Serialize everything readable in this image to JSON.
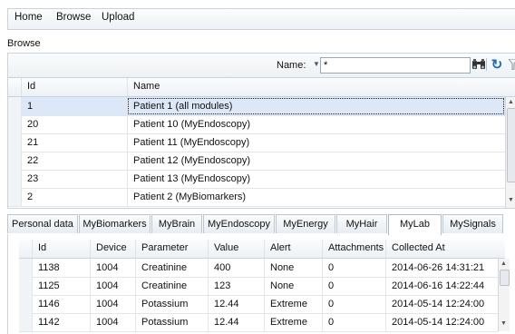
{
  "menu": {
    "items": [
      "Home",
      "Browse",
      "Upload"
    ]
  },
  "breadcrumb": "Browse",
  "filter": {
    "label": "Name:",
    "value": "*"
  },
  "patients": {
    "columns": [
      "Id",
      "Name"
    ],
    "rows": [
      [
        "1",
        "Patient 1 (all modules)"
      ],
      [
        "20",
        "Patient 10 (MyEndoscopy)"
      ],
      [
        "21",
        "Patient 11 (MyEndoscopy)"
      ],
      [
        "22",
        "Patient 12 (MyEndoscopy)"
      ],
      [
        "23",
        "Patient 13 (MyEndoscopy)"
      ],
      [
        "2",
        "Patient 2 (MyBiomarkers)"
      ]
    ],
    "selected_index": 0
  },
  "tabs": {
    "items": [
      "Personal data",
      "MyBiomarkers",
      "MyBrain",
      "MyEndoscopy",
      "MyEnergy",
      "MyHair",
      "MyLab",
      "MySignals"
    ],
    "active": "MyLab"
  },
  "lab": {
    "columns": [
      "Id",
      "Device",
      "Parameter",
      "Value",
      "Alert",
      "Attachments",
      "Collected At"
    ],
    "rows": [
      [
        "1138",
        "1004",
        "Creatinine",
        "400",
        "None",
        "0",
        "2014-06-26 14:31:21"
      ],
      [
        "1125",
        "1004",
        "Creatinine",
        "123",
        "None",
        "0",
        "2014-06-16 14:22:44"
      ],
      [
        "1146",
        "1004",
        "Potassium",
        "12.44",
        "Extreme",
        "0",
        "2014-05-14 12:24:00"
      ],
      [
        "1142",
        "1004",
        "Potassium",
        "12.44",
        "Extreme",
        "0",
        "2014-05-14 12:24:00"
      ]
    ]
  },
  "icons": {
    "search": "binoculars-icon",
    "refresh": "refresh-icon",
    "filter": "funnel-icon"
  }
}
